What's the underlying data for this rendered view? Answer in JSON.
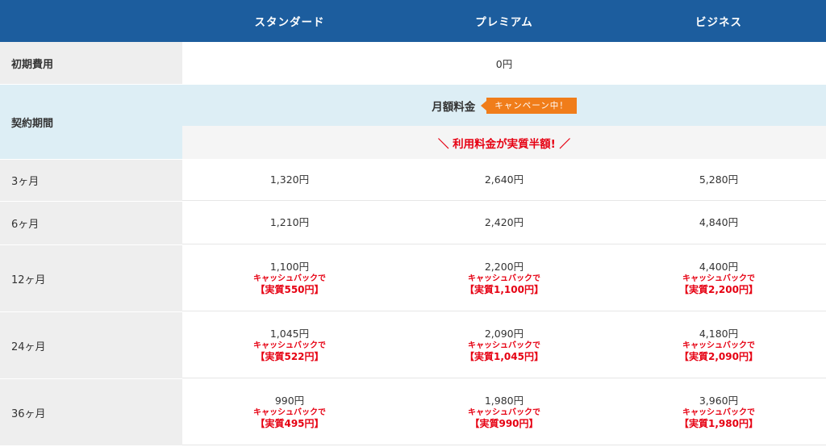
{
  "header": {
    "plans": [
      "スタンダード",
      "プレミアム",
      "ビジネス"
    ]
  },
  "initial_fee": {
    "label": "初期費用",
    "value": "0円"
  },
  "contract": {
    "label": "契約期間",
    "monthly_label": "月額料金",
    "campaign_badge": "キャンペーン中！",
    "half_price_text": "＼ 利用料金が実質半額! ／"
  },
  "rows": [
    {
      "label": "3ヶ月",
      "prices": [
        "1,320円",
        "2,640円",
        "5,280円"
      ]
    },
    {
      "label": "6ヶ月",
      "prices": [
        "1,210円",
        "2,420円",
        "4,840円"
      ]
    },
    {
      "label": "12ヶ月",
      "prices": [
        "1,100円",
        "2,200円",
        "4,400円"
      ],
      "cashback": [
        "キャッシュバックで",
        "キャッシュバックで",
        "キャッシュバックで"
      ],
      "real": [
        "【実質550円】",
        "【実質1,100円】",
        "【実質2,200円】"
      ]
    },
    {
      "label": "24ヶ月",
      "prices": [
        "1,045円",
        "2,090円",
        "4,180円"
      ],
      "cashback": [
        "キャッシュバックで",
        "キャッシュバックで",
        "キャッシュバックで"
      ],
      "real": [
        "【実質522円】",
        "【実質1,045円】",
        "【実質2,090円】"
      ]
    },
    {
      "label": "36ヶ月",
      "prices": [
        "990円",
        "1,980円",
        "3,960円"
      ],
      "cashback": [
        "キャッシュバックで",
        "キャッシュバックで",
        "キャッシュバックで"
      ],
      "real": [
        "【実質495円】",
        "【実質990円】",
        "【実質1,980円】"
      ]
    }
  ],
  "colors": {
    "header_bg": "#1c5d9e",
    "label_bg": "#eeeeee",
    "contract_bg": "#ddeef5",
    "badge_bg": "#f07d1a",
    "accent_red": "#e60012"
  }
}
